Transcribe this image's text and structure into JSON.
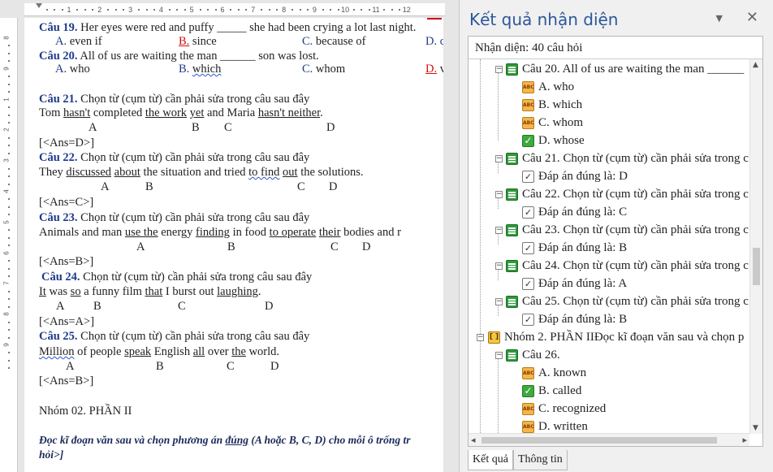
{
  "ruler": {
    "numbers": [
      "1",
      "2",
      "3",
      "4",
      "5",
      "6",
      "7",
      "8",
      "9",
      "10",
      "11",
      "12"
    ],
    "vnumbers": [
      "8",
      "9",
      "1",
      "2",
      "3",
      "4",
      "5",
      "6",
      "7",
      "8",
      "9"
    ]
  },
  "document": {
    "q19": {
      "label": "Câu 19.",
      "text": "Her eyes were red and puffy _____ she had been crying a lot last night."
    },
    "q19_opts": {
      "a": "A.",
      "a_text": " even if",
      "b": "B.",
      "b_text": " since",
      "c": "C.",
      "c_text": " because of",
      "d": "D. c"
    },
    "q20": {
      "label": "Câu 20.",
      "text": "All of us are waiting the man ______ son was lost."
    },
    "q20_opts": {
      "a": "A.",
      "a_text": " who",
      "b": "B.",
      "b_text": "which",
      "c": "C.",
      "c_text": " whom",
      "d": "D.",
      "d_text": " v"
    },
    "q21": {
      "label": "Câu 21.",
      "text": " Chọn từ (cụm từ) cần phải sửa trong câu sau đây"
    },
    "q21_s": {
      "p1": "Tom ",
      "w1": "hasn't",
      "p2": " completed ",
      "w2": "the work",
      "p3": " ",
      "w3": "yet",
      "p4": " and Maria ",
      "w4": "hasn't neither",
      "p5": "."
    },
    "q21_letters": {
      "a": "A",
      "b": "B",
      "c": "C",
      "d": "D"
    },
    "q21_ans": "[<Ans=D>]",
    "q22": {
      "label": "Câu 22.",
      "text": " Chọn từ (cụm từ) cần phải sửa trong câu sau đây"
    },
    "q22_s": {
      "p1": "They ",
      "w1": "discussed",
      "p2": " ",
      "w2": "about",
      "p3": " the situation and tried ",
      "w3": "to find",
      "p4": "  ",
      "w4": "out",
      "p5": " the solutions."
    },
    "q22_letters": {
      "a": "A",
      "b": "B",
      "c": "C",
      "d": "D"
    },
    "q22_ans": "[<Ans=C>]",
    "q23": {
      "label": "Câu 23.",
      "text": " Chọn từ (cụm từ) cần phải sửa trong câu sau đây"
    },
    "q23_s": {
      "p1": "Animals and man ",
      "w1": "use  the",
      "p2": " energy ",
      "w2": "finding",
      "p3": " in food ",
      "w3": "to operate",
      "p4": "  ",
      "w4": "their",
      "p5": " bodies and r"
    },
    "q23_letters": {
      "a": "A",
      "b": "B",
      "c": "C",
      "d": "D"
    },
    "q23_ans": "[<Ans=B>]",
    "q24": {
      "label": "Câu 24.",
      "text": " Chọn từ (cụm từ) cần phải sửa trong câu sau đây"
    },
    "q24_s": {
      "w1": "It",
      "p1": " was ",
      "w2": "so",
      "p2": " a funny film ",
      "w3": "that",
      "p3": " I burst out ",
      "w4": "laughing",
      "p4": "."
    },
    "q24_letters": {
      "a": "A",
      "b": "B",
      "c": "C",
      "d": "D"
    },
    "q24_ans": "[<Ans=A>]",
    "q25": {
      "label": "Câu 25.",
      "text": " Chọn từ (cụm từ) cần phải sửa trong câu sau đây"
    },
    "q25_s": {
      "w1": "Million",
      "p1": " of people ",
      "w2": "speak",
      "p2": " English ",
      "w3": "all",
      "p3": " over ",
      "w4": "the",
      "p4": " world."
    },
    "q25_letters": {
      "a": "A",
      "b": "B",
      "c": "C",
      "d": "D"
    },
    "q25_ans": "[<Ans=B>]",
    "group2": "Nhóm 02. PHẦN II",
    "instruction_1": "Đọc kĩ đoạn văn sau và chọn phương án ",
    "instruction_u": "đúng",
    "instruction_2": "  (A hoặc B, C, D) cho mỗi ô trống tr",
    "instruction_3": "hỏi>]"
  },
  "panel": {
    "title": "Kết quả nhận diện",
    "menu_icon": "▼",
    "close_icon": "✕",
    "recognized": "Nhận diện: 40 câu hỏi",
    "tree": {
      "q20": "Câu 20. All of us are waiting the man ______",
      "q20_a": "A. who",
      "q20_b": "B. which",
      "q20_c": "C. whom",
      "q20_d": "D. whose",
      "q21": "Câu 21. Chọn từ (cụm từ) cần phải sửa trong c",
      "q21_ans": "Đáp án đúng là: D",
      "q22": "Câu 22. Chọn từ (cụm từ) cần phải sửa trong c",
      "q22_ans": "Đáp án đúng là: C",
      "q23": "Câu 23. Chọn từ (cụm từ) cần phải sửa trong c",
      "q23_ans": "Đáp án đúng là: B",
      "q24": "Câu 24. Chọn từ (cụm từ) cần phải sửa trong c",
      "q24_ans": "Đáp án đúng là: A",
      "q25": "Câu 25. Chọn từ (cụm từ) cần phải sửa trong c",
      "q25_ans": "Đáp án đúng là: B",
      "group2": "Nhóm 2. PHẦN IIĐọc kĩ đoạn văn sau và chọn p",
      "q26": "Câu 26.",
      "q26_a": "A. known",
      "q26_b": "B. called",
      "q26_c": "C. recognized",
      "q26_d": "D. written"
    },
    "tabs": {
      "result": "Kết quả",
      "info": "Thông tin"
    }
  }
}
